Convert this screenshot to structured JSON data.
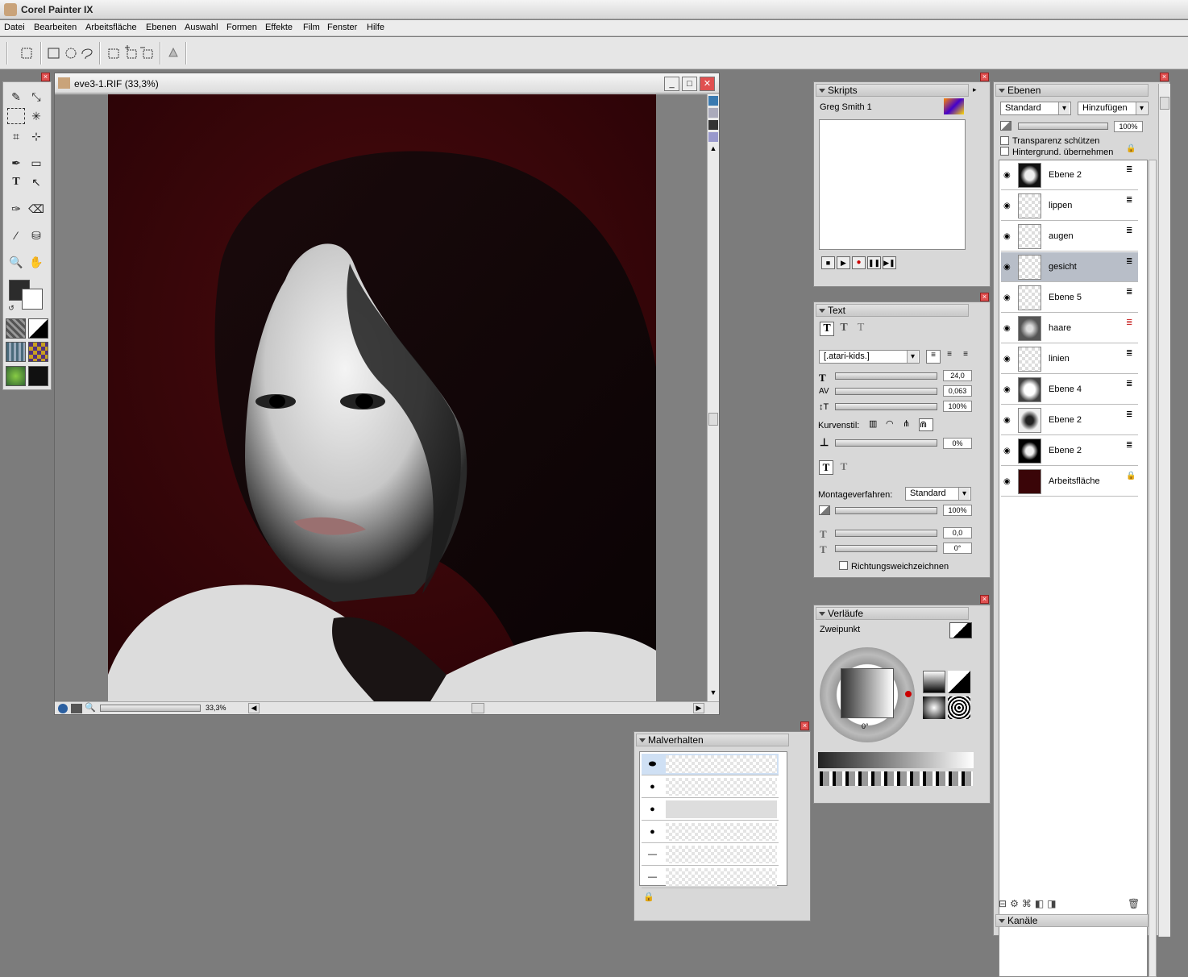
{
  "app": {
    "title": "Corel Painter IX"
  },
  "menu": [
    "Datei",
    "Bearbeiten",
    "Arbeitsfläche",
    "Ebenen",
    "Auswahl",
    "Formen",
    "Effekte",
    "Film",
    "Fenster",
    "Hilfe"
  ],
  "document": {
    "title": "eve3-1.RIF (33,3%)",
    "zoom": "33,3%"
  },
  "colors": {
    "canvas_bg": "#3a0508",
    "accent_record": "#cc0000",
    "panel": "#d8d8d8"
  },
  "scripts": {
    "title": "Skripts",
    "selected": "Greg Smith 1"
  },
  "text_panel": {
    "title": "Text",
    "font": "[.atari-kids.]",
    "size": "24,0",
    "tracking": "0,063",
    "leading": "100%",
    "curve_label": "Kurvenstil:",
    "curve_value": "0%",
    "composite_label": "Montageverfahren:",
    "composite_value": "Standard",
    "opacity": "100%",
    "shadow_x": "0,0",
    "angle": "0°",
    "blur_label": "Richtungsweichzeichnen"
  },
  "gradients": {
    "title": "Verläufe",
    "type": "Zweipunkt",
    "angle": "0°"
  },
  "brush_behavior": {
    "title": "Malverhalten"
  },
  "layers": {
    "title": "Ebenen",
    "composite": "Standard",
    "mode": "Hinzufügen",
    "opacity": "100%",
    "preserve_transparency": "Transparenz schützen",
    "pick_up_underlying": "Hintergrund. übernehmen",
    "items": [
      {
        "name": "Ebene 2"
      },
      {
        "name": "lippen"
      },
      {
        "name": "augen"
      },
      {
        "name": "gesicht"
      },
      {
        "name": "Ebene 5"
      },
      {
        "name": "haare"
      },
      {
        "name": "linien"
      },
      {
        "name": "Ebene 4"
      },
      {
        "name": "Ebene 2"
      },
      {
        "name": "Ebene 2"
      },
      {
        "name": "Arbeitsfläche"
      }
    ]
  },
  "channels": {
    "title": "Kanäle"
  }
}
